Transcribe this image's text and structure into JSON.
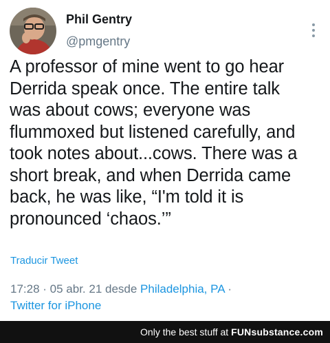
{
  "tweet": {
    "author_name": "Phil Gentry",
    "author_handle": "@pmgentry",
    "text_lines": [
      "A professor of mine went to go hear",
      "Derrida speak once. The entire talk",
      "was about cows; everyone was",
      "flummoxed but listened carefully, and",
      "took notes about...cows. There was a",
      "short break, and when Derrida came",
      "back, he was like, “I'm told it is",
      "pronounced ‘chaos.’”"
    ],
    "translate_label": "Traducir Tweet",
    "time": "17:28",
    "separator": " · ",
    "date": "05 abr. 21",
    "from_label": " desde ",
    "location": "Philadelphia, PA",
    "trailing_separator": " ·",
    "client": "Twitter for iPhone",
    "more_icon": "more-vertical-icon"
  },
  "footer": {
    "prefix": "Only the best stuff at ",
    "brand": "FUNsubstance.com"
  },
  "colors": {
    "link": "#1b95e0",
    "muted": "#657786",
    "text": "#14171a",
    "footer_bg": "#111111"
  }
}
